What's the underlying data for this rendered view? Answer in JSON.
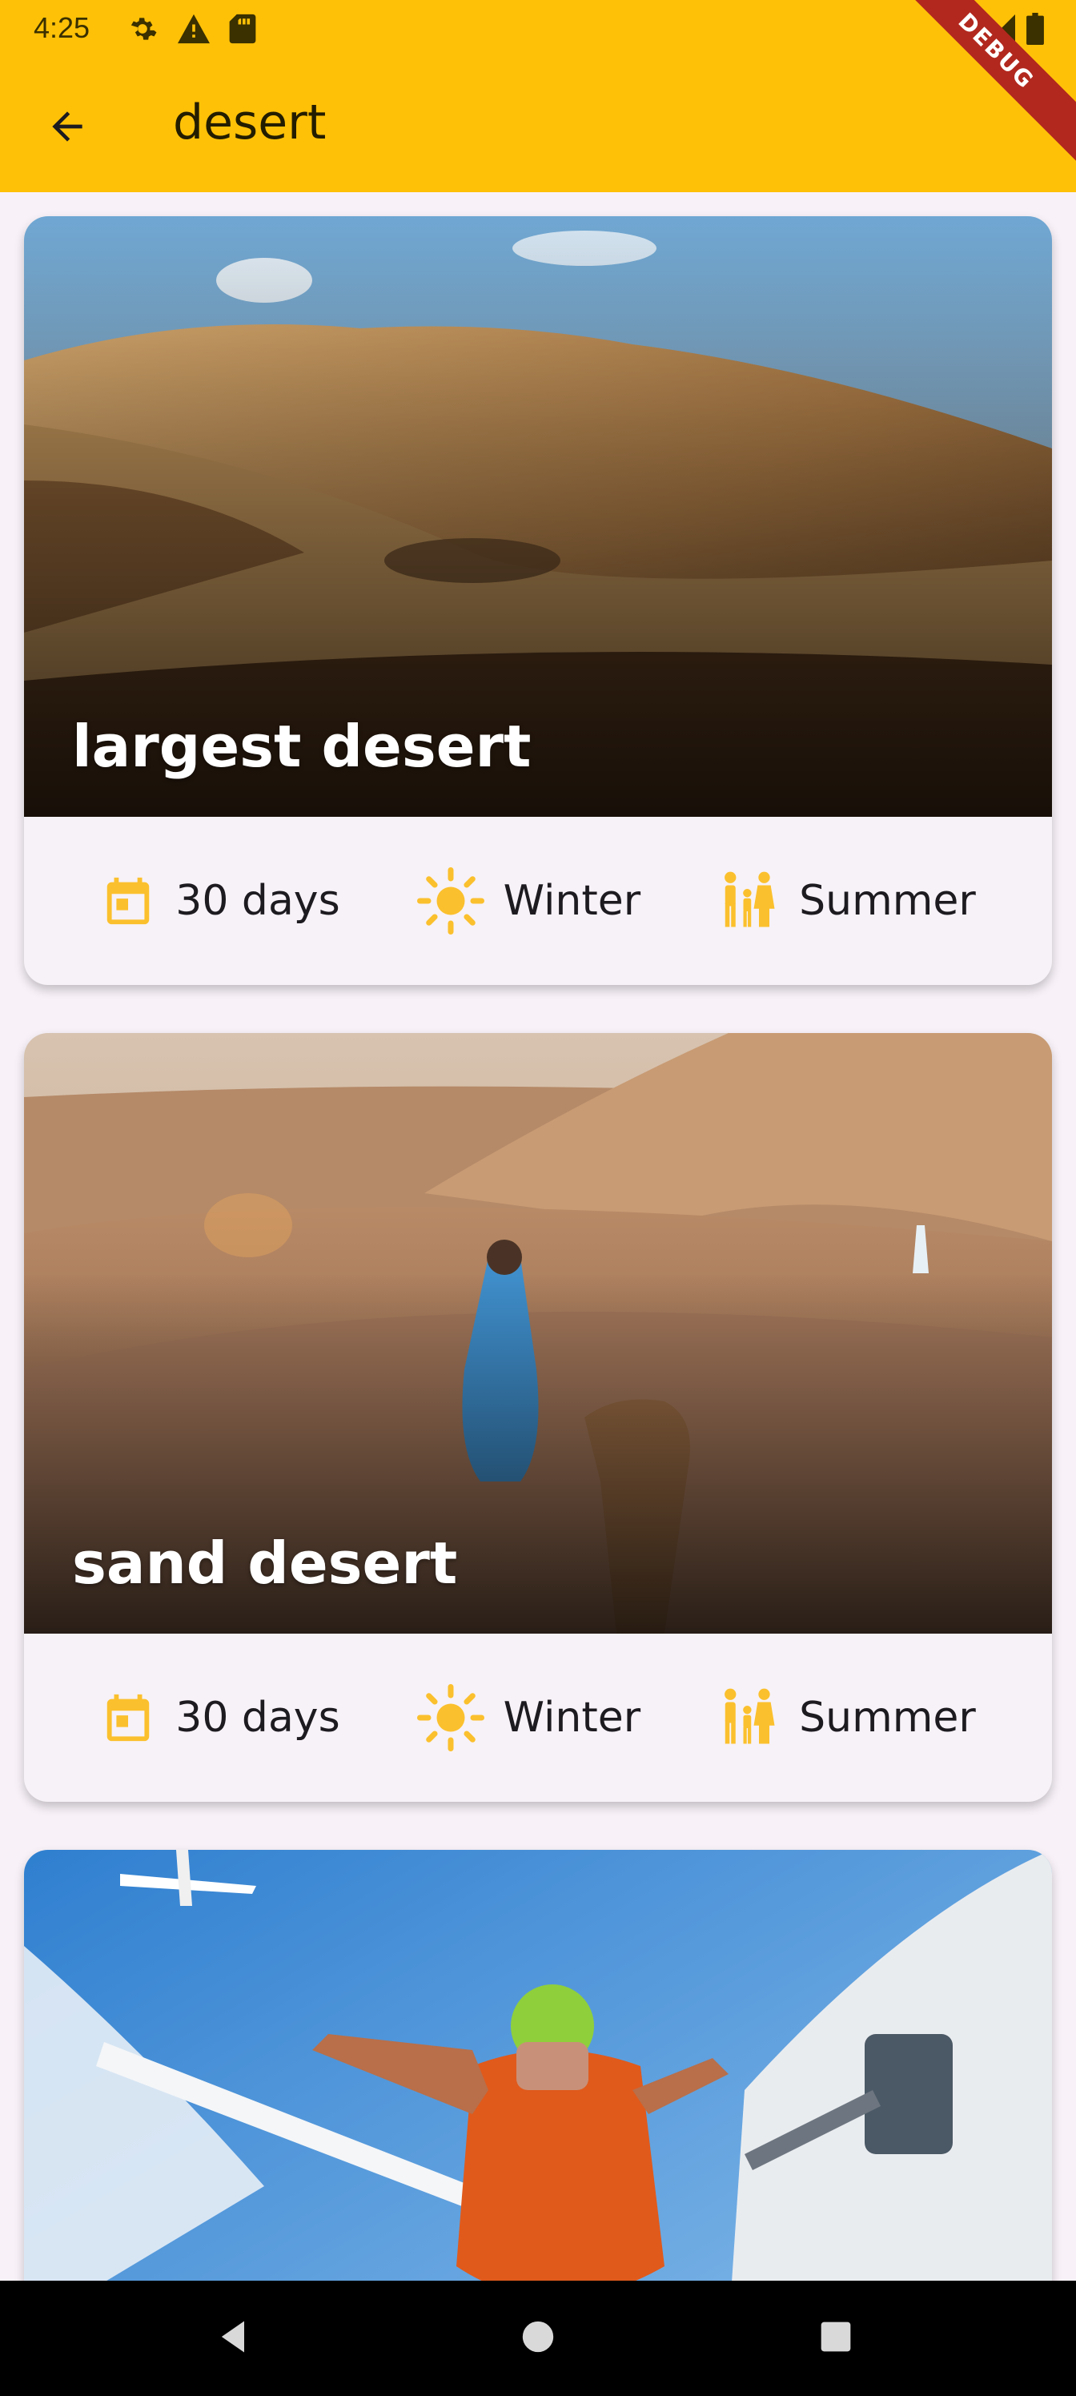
{
  "status_bar": {
    "time": "4:25",
    "left_icons": [
      "gear-icon",
      "warning-icon",
      "sd-card-icon"
    ],
    "right_icons": [
      "wifi-icon",
      "signal-icon",
      "battery-icon"
    ]
  },
  "app_bar": {
    "title": "desert",
    "back_icon": "arrow-left-icon",
    "color": "#ffc107"
  },
  "debug_banner": "DEBUG",
  "cards": [
    {
      "title": "largest desert",
      "info": [
        {
          "icon": "calendar-icon",
          "label": "30 days"
        },
        {
          "icon": "sun-icon",
          "label": "Winter"
        },
        {
          "icon": "family-icon",
          "label": "Summer"
        }
      ]
    },
    {
      "title": "sand desert",
      "info": [
        {
          "icon": "calendar-icon",
          "label": "30 days"
        },
        {
          "icon": "sun-icon",
          "label": "Winter"
        },
        {
          "icon": "family-icon",
          "label": "Summer"
        }
      ]
    },
    {
      "title": "",
      "info": []
    }
  ],
  "nav_bar": {
    "buttons": [
      "back-triangle-icon",
      "home-circle-icon",
      "recents-square-icon"
    ]
  },
  "accent_color": "#fbc02d"
}
